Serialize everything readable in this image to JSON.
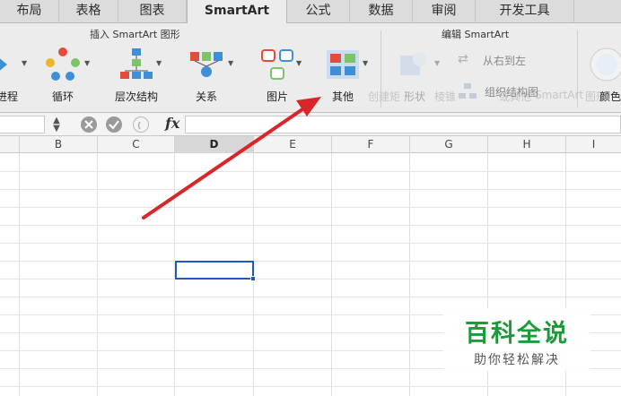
{
  "tabs": [
    {
      "label": "布局",
      "active": false
    },
    {
      "label": "表格",
      "active": false
    },
    {
      "label": "图表",
      "active": false
    },
    {
      "label": "SmartArt",
      "active": true
    },
    {
      "label": "公式",
      "active": false
    },
    {
      "label": "数据",
      "active": false
    },
    {
      "label": "审阅",
      "active": false
    },
    {
      "label": "开发工具",
      "active": false
    }
  ],
  "ribbon": {
    "insert_group_title": "插入 SmartArt 图形",
    "edit_group_title": "编辑 SmartArt",
    "insert_buttons": [
      {
        "label": "进程",
        "icon": "process-icon"
      },
      {
        "label": "循环",
        "icon": "cycle-icon"
      },
      {
        "label": "层次结构",
        "icon": "hierarchy-icon"
      },
      {
        "label": "关系",
        "icon": "relationship-icon"
      },
      {
        "label": "图片",
        "icon": "picture-icon"
      },
      {
        "label": "其他",
        "icon": "other-icon"
      }
    ],
    "edit_buttons": {
      "shape_label": "形状",
      "rtl_label": "从右到左",
      "org_label": "组织结构图",
      "color_label": "颜色"
    },
    "faded_labels": [
      "创建矩",
      "棱锥",
      "或其他",
      "SmartArt",
      "图形"
    ]
  },
  "formula_bar": {
    "fx_label": "fx",
    "value": ""
  },
  "columns": [
    "",
    "B",
    "C",
    "D",
    "E",
    "F",
    "G",
    "H",
    "I"
  ],
  "selected_column": "D",
  "colors": {
    "accent": "#1f5bbf",
    "arrow": "#d9262a",
    "watermark": "#1d9a3a"
  },
  "watermark": {
    "title": "百科全说",
    "subtitle": "助你轻松解决"
  }
}
